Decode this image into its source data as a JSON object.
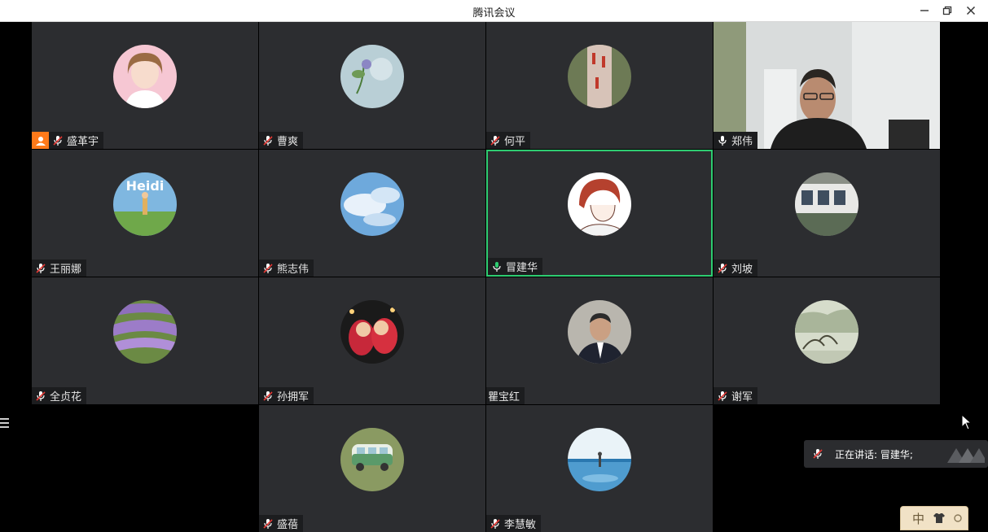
{
  "window": {
    "title": "腾讯会议",
    "controls": [
      "minimize-icon",
      "restore-icon",
      "close-icon"
    ]
  },
  "participants": [
    {
      "name": "盛革宇",
      "mic": "muted",
      "host": true
    },
    {
      "name": "曹爽",
      "mic": "muted"
    },
    {
      "name": "何平",
      "mic": "muted"
    },
    {
      "name": "郑伟",
      "mic": "on",
      "video": true
    },
    {
      "name": "王丽娜",
      "mic": "muted"
    },
    {
      "name": "熊志伟",
      "mic": "muted"
    },
    {
      "name": "冒建华",
      "mic": "speaking",
      "active_speaker": true
    },
    {
      "name": "刘坡",
      "mic": "muted"
    },
    {
      "name": "全贞花",
      "mic": "muted"
    },
    {
      "name": "孙拥军",
      "mic": "muted"
    },
    {
      "name": "瞿宝红",
      "mic": "none"
    },
    {
      "name": "谢军",
      "mic": "muted"
    },
    {
      "name": "盛蓓",
      "mic": "muted"
    },
    {
      "name": "李慧敏",
      "mic": "muted"
    }
  ],
  "speaking_banner": {
    "text": "正在讲话: 冒建华;"
  },
  "ime": {
    "mode": "中"
  },
  "colors": {
    "active_border": "#2ecc71",
    "host_badge": "#ff7a1a",
    "tile_bg": "#2c2d30",
    "page_bg": "#000000"
  }
}
